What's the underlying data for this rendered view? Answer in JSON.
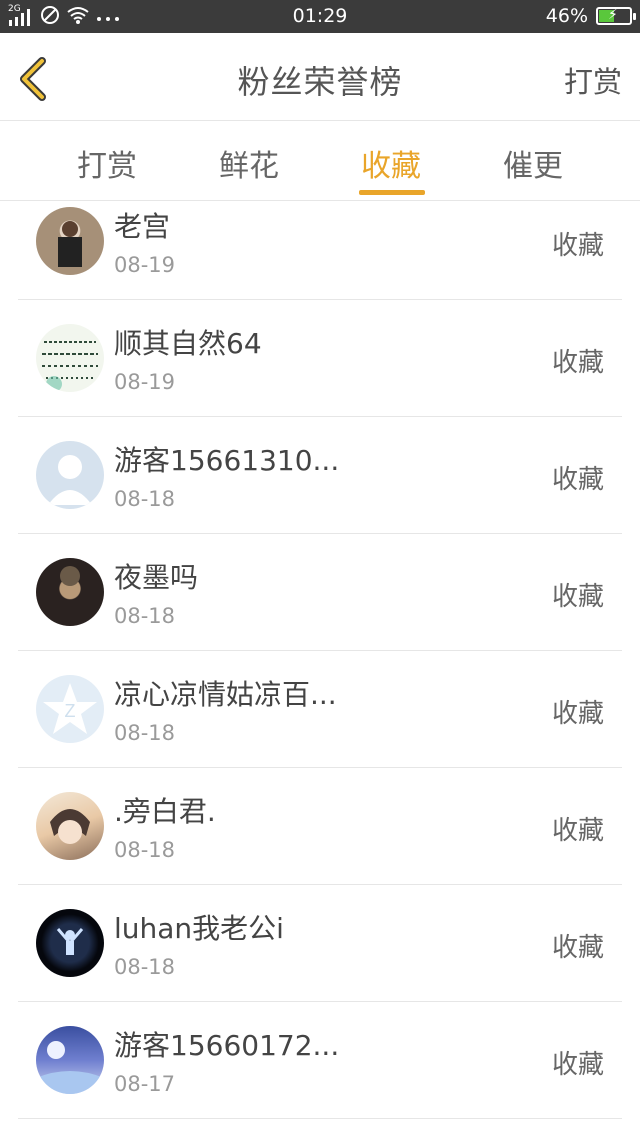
{
  "status_bar": {
    "network": "2G",
    "time": "01:29",
    "battery": "46%",
    "battery_level": 0.46,
    "icons": [
      "signal-icon",
      "do-not-disturb-icon",
      "wifi-icon",
      "more-dots-icon",
      "battery-icon"
    ]
  },
  "header": {
    "title": "粉丝荣誉榜",
    "action": "打赏",
    "back_icon": "chevron-left-icon",
    "accent": "#e9a52a"
  },
  "tabs": [
    {
      "label": "打赏",
      "active": false
    },
    {
      "label": "鲜花",
      "active": false
    },
    {
      "label": "收藏",
      "active": true
    },
    {
      "label": "催更",
      "active": false
    }
  ],
  "list": [
    {
      "name": "老宫",
      "date": "08-19",
      "action": "收藏"
    },
    {
      "name": "顺其自然64",
      "date": "08-19",
      "action": "收藏"
    },
    {
      "name": "游客15661310...",
      "date": "08-18",
      "action": "收藏"
    },
    {
      "name": "夜墨吗",
      "date": "08-18",
      "action": "收藏"
    },
    {
      "name": "凉心凉情姑凉百...",
      "date": "08-18",
      "action": "收藏"
    },
    {
      "name": ".旁白君.",
      "date": "08-18",
      "action": "收藏"
    },
    {
      "name": "luhan我老公i",
      "date": "08-18",
      "action": "收藏"
    },
    {
      "name": "游客15660172...",
      "date": "08-17",
      "action": "收藏"
    }
  ]
}
